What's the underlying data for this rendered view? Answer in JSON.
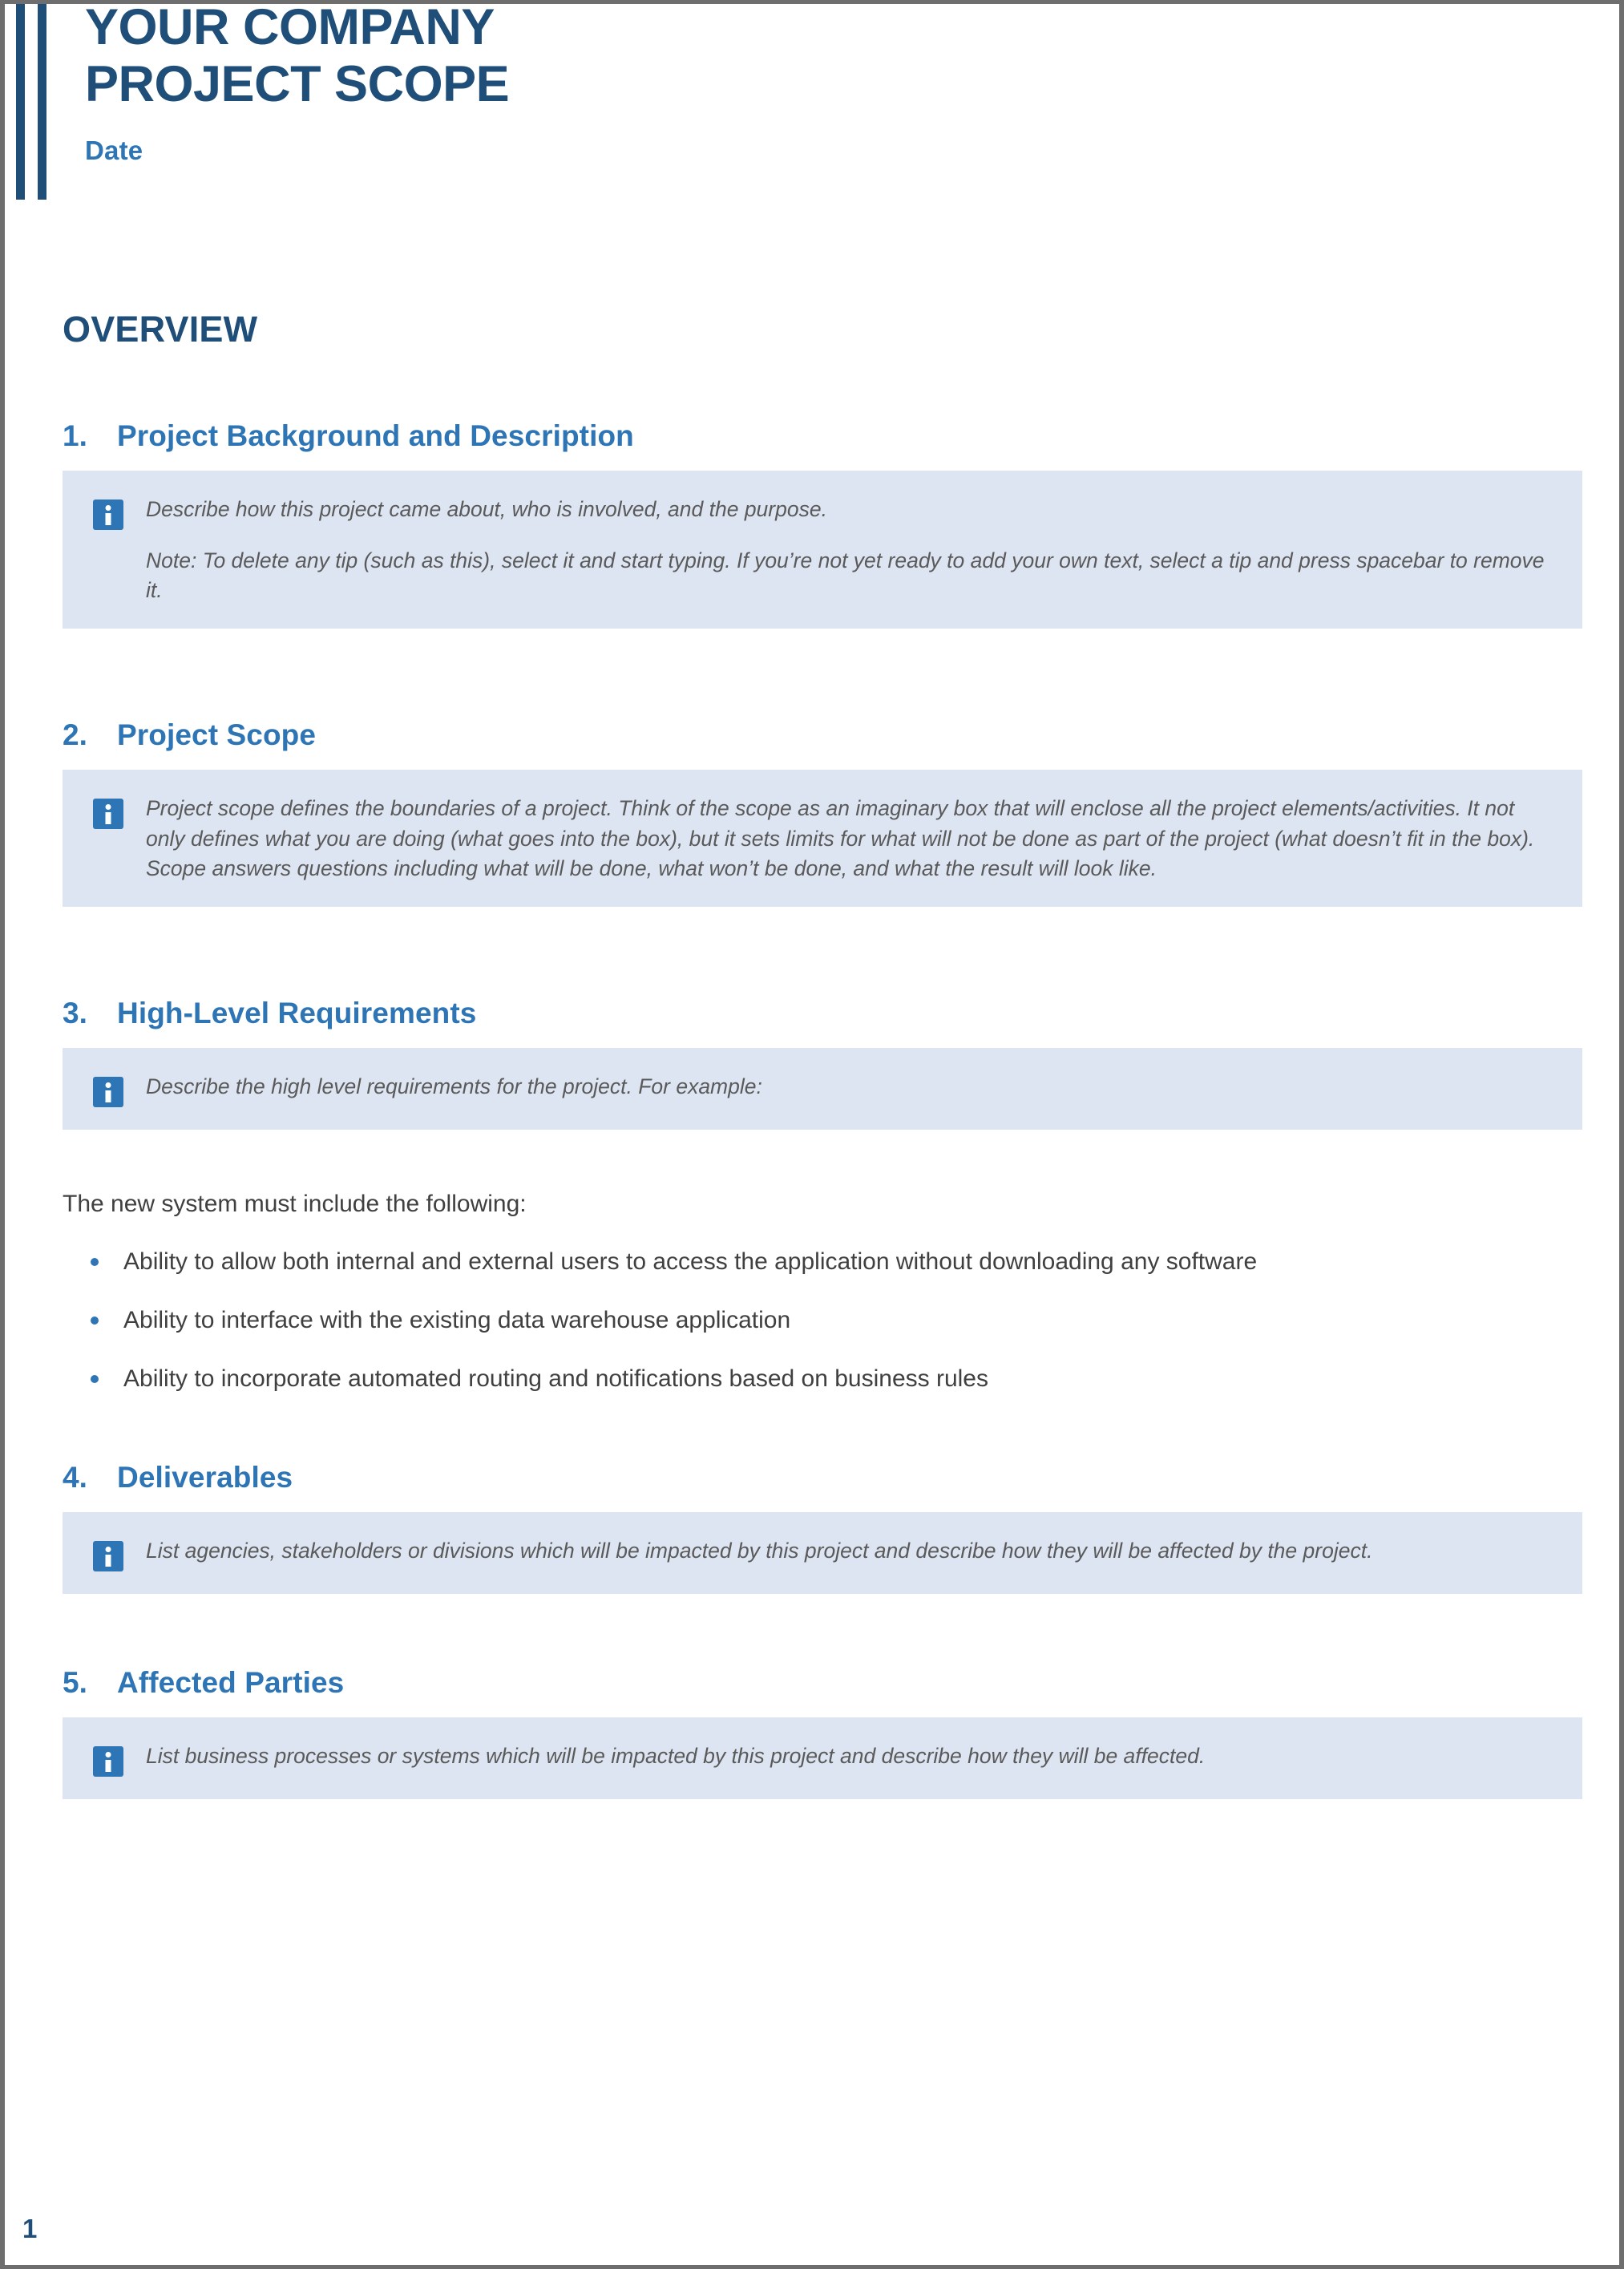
{
  "document": {
    "title_line1": "YOUR COMPANY",
    "title_line2": "PROJECT SCOPE",
    "date_label": "Date",
    "page_number": "1",
    "colors": {
      "title_blue": "#1F4E79",
      "heading_blue": "#2E75B6",
      "tip_background": "#DDE5F2",
      "tip_text_gray": "#5A5A5A",
      "body_text_gray": "#404040"
    }
  },
  "overview": {
    "heading": "OVERVIEW"
  },
  "sections": [
    {
      "number": "1.",
      "title": "Project Background and Description",
      "tip_icon": "info-icon",
      "tip_paragraphs": [
        "Describe how this project came about, who is involved, and the purpose.",
        "Note: To delete any tip (such as this), select it and start typing. If you’re not yet ready to add your own text, select a tip and press spacebar to remove it."
      ]
    },
    {
      "number": "2.",
      "title": "Project Scope",
      "tip_icon": "info-icon",
      "tip_paragraphs": [
        "Project scope defines the boundaries of a project. Think of the scope as an imaginary box that will enclose all the project elements/activities. It not only defines what you are doing (what goes into the box), but it sets limits for what will not be done as part of the project (what doesn’t fit in the box). Scope answers questions including what will be done, what won’t be done, and what the result will look like."
      ]
    },
    {
      "number": "3.",
      "title": "High-Level Requirements",
      "tip_icon": "info-icon",
      "tip_paragraphs": [
        "Describe the high level requirements for the project. For example:"
      ],
      "lead_in": "The new system must include the following:",
      "bullets": [
        "Ability to allow both internal and external users to access the application without downloading any software",
        "Ability to interface with the existing data warehouse application",
        "Ability to incorporate automated routing and notifications based on business rules"
      ]
    },
    {
      "number": "4.",
      "title": "Deliverables",
      "tip_icon": "info-icon",
      "tip_paragraphs": [
        "List agencies, stakeholders or divisions which will be impacted by this project and describe how they will be affected by the project."
      ]
    },
    {
      "number": "5.",
      "title": "Affected Parties",
      "tip_icon": "info-icon",
      "tip_paragraphs": [
        "List business processes or systems which will be impacted by this project and describe how they will be affected."
      ]
    }
  ]
}
